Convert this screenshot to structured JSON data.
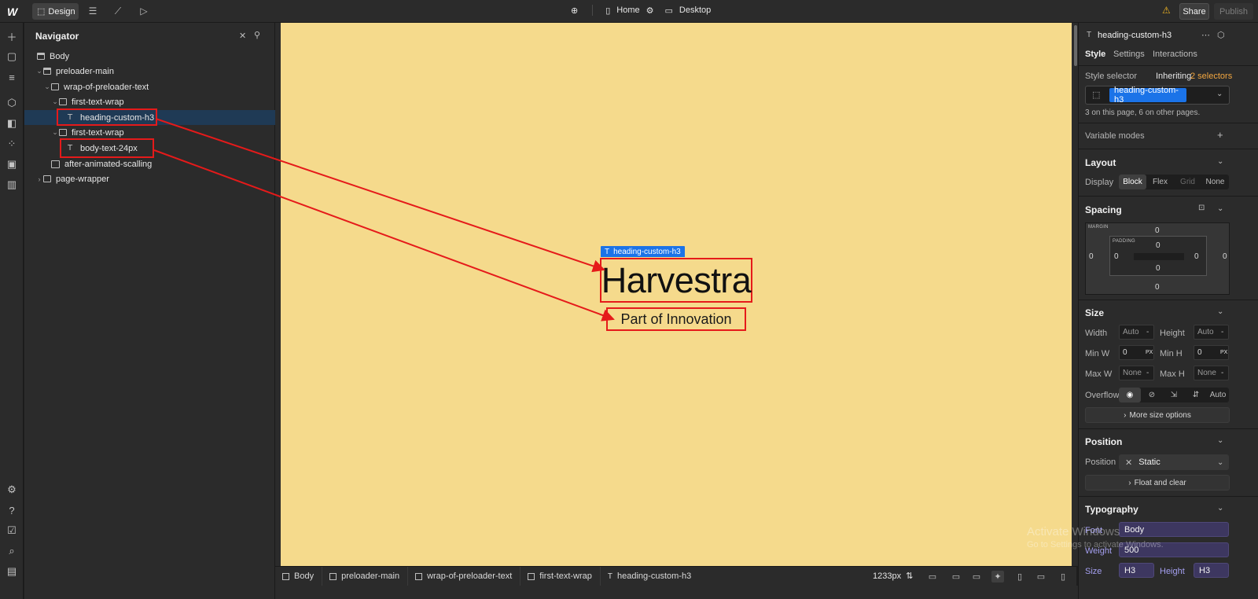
{
  "topbar": {
    "logo": "W",
    "mode_label": "Design",
    "page_label": "Home",
    "breakpoint_label": "Desktop",
    "share_label": "Share",
    "publish_label": "Publish"
  },
  "navigator": {
    "title": "Navigator",
    "rows": [
      {
        "label": "Body"
      },
      {
        "label": "preloader-main"
      },
      {
        "label": "wrap-of-preloader-text"
      },
      {
        "label": "first-text-wrap"
      },
      {
        "label": "heading-custom-h3"
      },
      {
        "label": "first-text-wrap"
      },
      {
        "label": "body-text-24px"
      },
      {
        "label": "after-animated-scalling"
      },
      {
        "label": "page-wrapper"
      }
    ]
  },
  "canvas": {
    "selection_tag": "heading-custom-h3",
    "heading_text": "Harvestra",
    "subtext": "Part of Innovation",
    "colors": {
      "background": "#f5da8c",
      "annotation": "#e51a1a",
      "selection": "#1b73e8"
    }
  },
  "breadcrumb": {
    "items": [
      "Body",
      "preloader-main",
      "wrap-of-preloader-text",
      "first-text-wrap",
      "heading-custom-h3"
    ],
    "width_readout": "1233px"
  },
  "style_panel": {
    "element_name": "heading-custom-h3",
    "tabs": [
      "Style",
      "Settings",
      "Interactions"
    ],
    "style_selector_label": "Style selector",
    "inheriting_label": "Inheriting",
    "inheriting_count": "2 selectors",
    "selector_chip": "heading-custom-h3",
    "usage_text": "3 on this page, 6 on other pages.",
    "variable_modes_label": "Variable modes",
    "layout": {
      "heading": "Layout",
      "display_label": "Display",
      "options": [
        "Block",
        "Flex",
        "Grid",
        "None"
      ]
    },
    "spacing": {
      "heading": "Spacing",
      "margin_label": "MARGIN",
      "padding_label": "PADDING",
      "margin": {
        "top": "0",
        "right": "0",
        "bottom": "0",
        "left": "0"
      },
      "padding": {
        "top": "0",
        "right": "0",
        "bottom": "0",
        "left": "0"
      }
    },
    "size": {
      "heading": "Size",
      "width_label": "Width",
      "width_value": "Auto",
      "height_label": "Height",
      "height_value": "Auto",
      "min_w_label": "Min W",
      "min_w_value": "0",
      "min_w_unit": "PX",
      "min_h_label": "Min H",
      "min_h_value": "0",
      "min_h_unit": "PX",
      "max_w_label": "Max W",
      "max_w_value": "None",
      "max_h_label": "Max H",
      "max_h_value": "None",
      "overflow_label": "Overflow",
      "overflow_auto": "Auto",
      "more_options": "More size options"
    },
    "position": {
      "heading": "Position",
      "position_label": "Position",
      "value": "Static",
      "float_btn": "Float and clear"
    },
    "typography": {
      "heading": "Typography",
      "font_label": "Font",
      "font_value": "Body",
      "weight_label": "Weight",
      "weight_value": "500",
      "size_label": "Size",
      "size_value": "H3",
      "height_label": "Height",
      "height_value": "H3"
    }
  },
  "watermark": {
    "line1": "Activate Windows",
    "line2": "Go to Settings to activate Windows."
  }
}
